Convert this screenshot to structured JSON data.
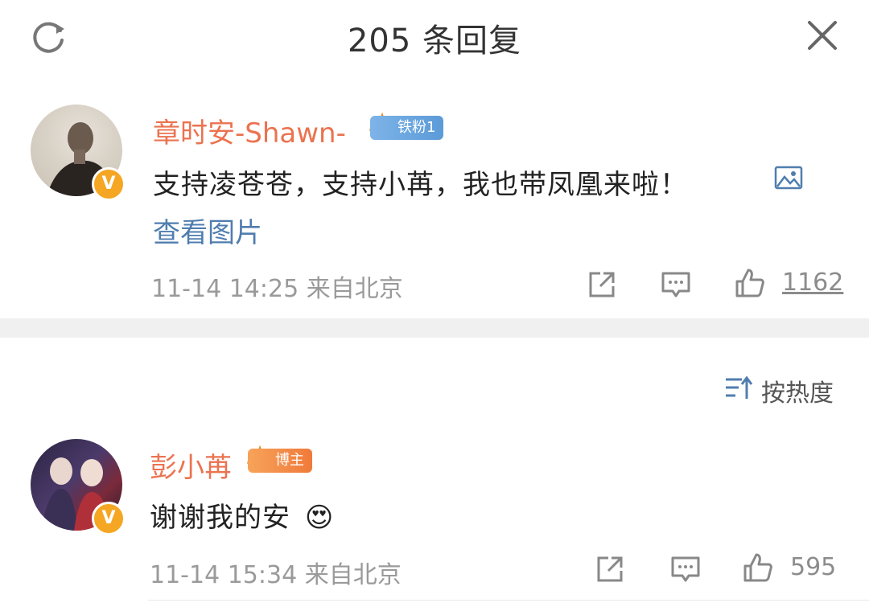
{
  "header": {
    "title": "205 条回复",
    "refresh_icon": "refresh-icon",
    "close_icon": "close-icon"
  },
  "main_comment": {
    "username": "章时安-Shawn-",
    "badge": "铁粉1",
    "text": "支持凌苍苍，支持小苒，我也带凤凰来啦！",
    "view_image": "查看图片",
    "meta": "11-14 14:25 来自北京",
    "likes": "1162",
    "verified_icon": "verified-v-icon"
  },
  "sort": {
    "label": "按热度"
  },
  "reply": {
    "username": "彭小苒",
    "badge": "博主",
    "text": "谢谢我的安",
    "emoji": "😍",
    "meta": "11-14 15:34 来自北京",
    "likes": "595"
  },
  "colors": {
    "username": "#eb7350",
    "link": "#507daf",
    "meta": "#9a9a9a",
    "verified": "#f5a623"
  }
}
